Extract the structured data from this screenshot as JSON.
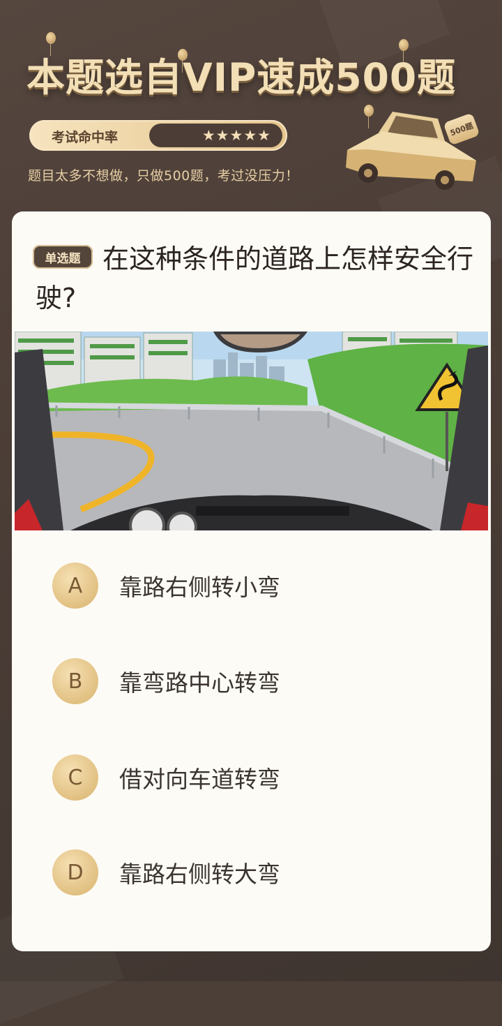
{
  "banner": {
    "title": "本题选自VIP速成500题",
    "rate_label": "考试命中率",
    "stars": "★★★★★",
    "slogan": "题目太多不想做，只做500题，考过没压力！",
    "badge": "500题"
  },
  "question": {
    "tag": "单选题",
    "text": "在这种条件的道路上怎样安全行驶?"
  },
  "options": [
    {
      "letter": "A",
      "text": "靠路右侧转小弯"
    },
    {
      "letter": "B",
      "text": "靠弯路中心转弯"
    },
    {
      "letter": "C",
      "text": "借对向车道转弯"
    },
    {
      "letter": "D",
      "text": "靠路右侧转大弯"
    }
  ],
  "colors": {
    "background": "#4b3f38",
    "gold": "#e5c48c",
    "card": "#fdfbf6",
    "text": "#2b2420"
  }
}
